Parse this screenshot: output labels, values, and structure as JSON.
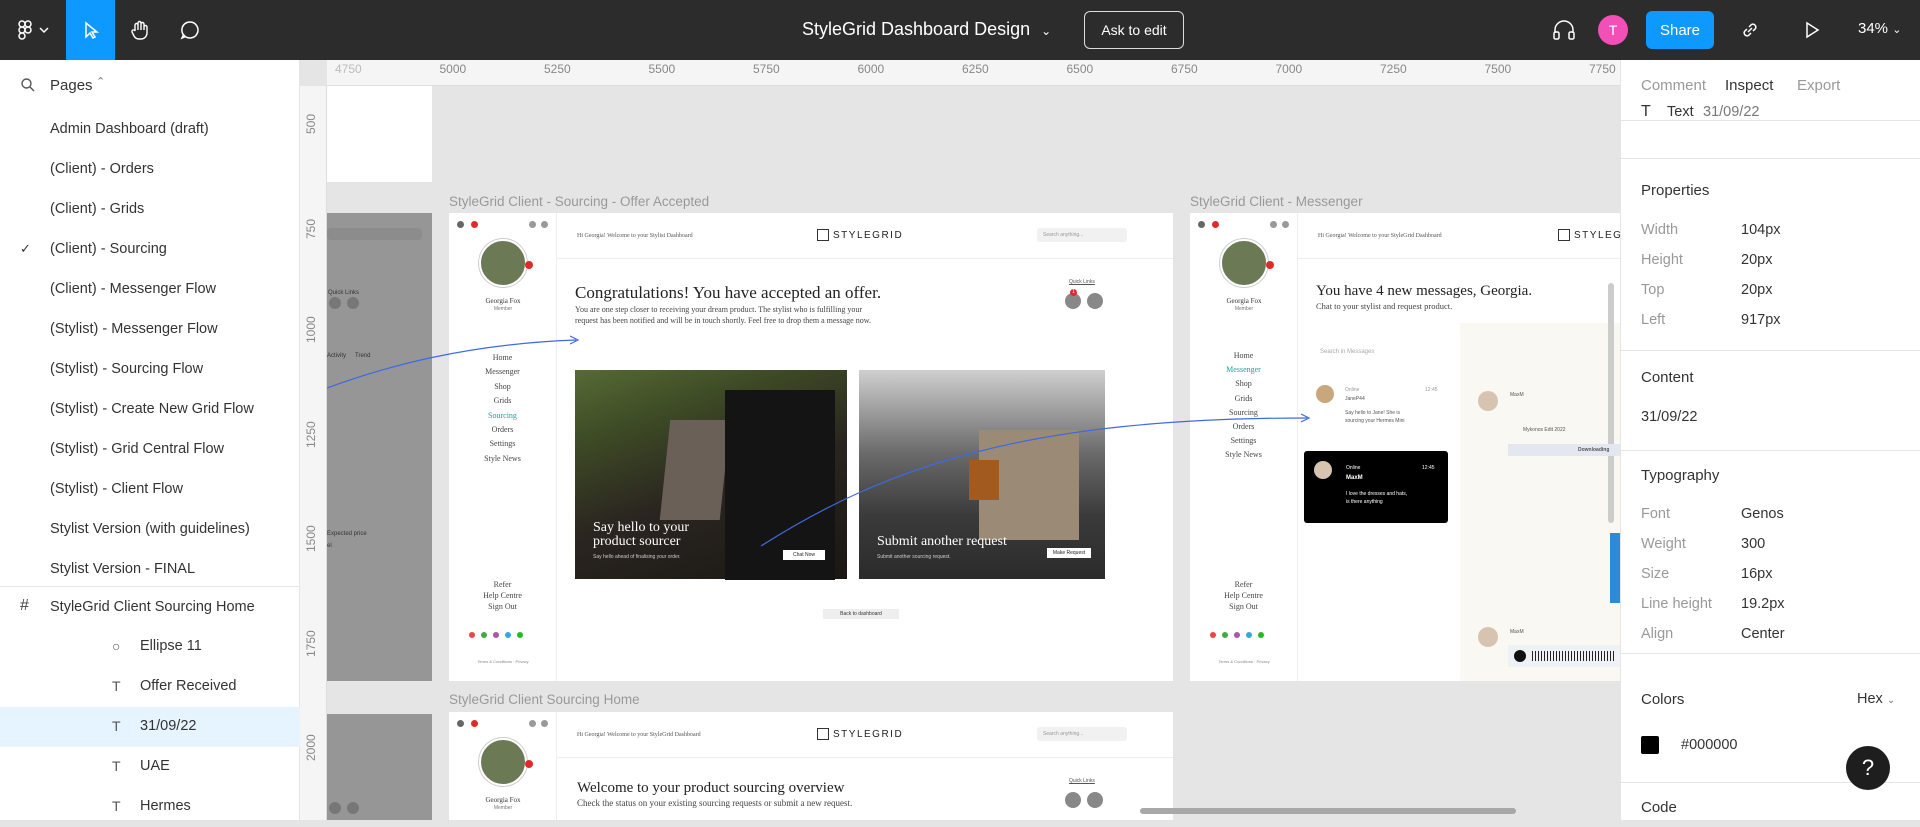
{
  "topbar": {
    "title": "StyleGrid Dashboard Design",
    "ask_to_edit": "Ask to edit",
    "avatar_initial": "T",
    "share": "Share",
    "zoom": "34%",
    "accent": "#0d99ff"
  },
  "pages_panel": {
    "label": "Pages",
    "items": [
      {
        "label": "Admin Dashboard (draft)"
      },
      {
        "label": "(Client) - Orders"
      },
      {
        "label": "(Client) - Grids"
      },
      {
        "label": "(Client) - Sourcing",
        "selected": true
      },
      {
        "label": "(Client) - Messenger Flow"
      },
      {
        "label": "(Stylist) - Messenger Flow"
      },
      {
        "label": "(Stylist) - Sourcing Flow"
      },
      {
        "label": "(Stylist) - Create New Grid Flow"
      },
      {
        "label": "(Stylist) - Grid Central Flow"
      },
      {
        "label": "(Stylist) - Client Flow"
      },
      {
        "label": "Stylist Version (with guidelines)"
      },
      {
        "label": "Stylist Version - FINAL"
      }
    ]
  },
  "layers": {
    "frame": "StyleGrid Client Sourcing Home",
    "items": [
      {
        "label": "Ellipse 11",
        "icon": "ellipse-icon"
      },
      {
        "label": "Offer Received",
        "icon": "text-icon"
      },
      {
        "label": "31/09/22",
        "icon": "text-icon",
        "selected": true
      },
      {
        "label": "UAE",
        "icon": "text-icon"
      },
      {
        "label": "Hermes",
        "icon": "text-icon"
      }
    ]
  },
  "ruler": {
    "top": [
      "4750",
      "5000",
      "5250",
      "5500",
      "5750",
      "6000",
      "6250",
      "6500",
      "6750",
      "7000",
      "7250",
      "7500",
      "7750"
    ],
    "left": [
      "500",
      "750",
      "1000",
      "1250",
      "1500",
      "1750",
      "2000"
    ]
  },
  "canvas": {
    "frame1_title": "StyleGrid Client - Sourcing - Offer Accepted",
    "frame2_title": "StyleGrid Client - Messenger",
    "frame3_title": "StyleGrid Client Sourcing Home",
    "left_partial": {
      "label1": "Quick Links",
      "t1": "Activity",
      "t2": "Trend",
      "t3": "Expected price",
      "t4": "el"
    },
    "f1": {
      "welcome": "Hi Georgia! Welcome to your Stylist Dashboard",
      "logo": "STYLEGRID",
      "search": "Search anything...",
      "quick_links": "Quick Links",
      "badge": "1",
      "profile_name": "Georgia Fox",
      "profile_role": "Member",
      "nav": [
        "Home",
        "Messenger",
        "Shop",
        "Grids",
        "Sourcing",
        "Orders",
        "Settings",
        "Style News"
      ],
      "bottom_nav": [
        "Refer",
        "Help Centre",
        "Sign Out"
      ],
      "footer": "Terms & Conditions · Privacy",
      "heading": "Congratulations! You have accepted an offer.",
      "sub1": "You are one step closer to receiving your dream product. The stylist who is fulfilling your",
      "sub2": "request has been notified and will be in touch shortly. Feel free to drop them a message now.",
      "card1_title1": "Say hello to your",
      "card1_title2": "product sourcer",
      "card1_sub": "Say hello ahead of finalising your order.",
      "card1_btn": "Chat Now",
      "card2_title": "Submit another request",
      "card2_sub": "Submit another sourcing request.",
      "card2_btn": "Make Request",
      "back": "Back to dashboard"
    },
    "f2": {
      "welcome": "Hi Georgia! Welcome to your StyleGrid Dashboard",
      "logo": "STYLEGR",
      "profile_name": "Georgia Fox",
      "profile_role": "Member",
      "nav": [
        "Home",
        "Messenger",
        "Shop",
        "Grids",
        "Sourcing",
        "Orders",
        "Settings",
        "Style News"
      ],
      "bottom_nav": [
        "Refer",
        "Help Centre",
        "Sign Out"
      ],
      "footer": "Terms & Conditions · Privacy",
      "heading": "You have 4 new messages, Georgia.",
      "sub": "Chat to your stylist and request product.",
      "search": "Search in Messages",
      "msg1_status": "Online",
      "msg1_time": "12:45",
      "msg1_name": "JaneP44",
      "msg1_text1": "Say hello to Jane! She is",
      "msg1_text2": "sourcing your Hermes Mini",
      "msg2_status": "Online",
      "msg2_time": "12:45",
      "msg2_name": "MaxM",
      "msg2_text1": "I love the dresses and hats,",
      "msg2_text2": "is there anything",
      "chat_name1": "MaxM",
      "chat_file": "Mykonos Edit 2022",
      "chat_download": "Downloading",
      "chat_name2": "MaxM"
    },
    "f3": {
      "welcome": "Hi Georgia! Welcome to your StyleGrid Dashboard",
      "logo": "STYLEGRID",
      "search": "Search anything...",
      "quick_links": "Quick Links",
      "profile_name": "Georgia Fox",
      "profile_role": "Member",
      "heading": "Welcome to your product sourcing overview",
      "sub": "Check the status on your existing sourcing requests or submit a new request."
    }
  },
  "inspect": {
    "tabs": [
      "Comment",
      "Inspect",
      "Export"
    ],
    "active_tab": "Inspect",
    "layer_type": "Text",
    "layer_name": "31/09/22",
    "properties_title": "Properties",
    "properties": [
      {
        "k": "Width",
        "v": "104px"
      },
      {
        "k": "Height",
        "v": "20px"
      },
      {
        "k": "Top",
        "v": "20px"
      },
      {
        "k": "Left",
        "v": "917px"
      }
    ],
    "content_title": "Content",
    "content": "31/09/22",
    "typography_title": "Typography",
    "typography": [
      {
        "k": "Font",
        "v": "Genos"
      },
      {
        "k": "Weight",
        "v": "300"
      },
      {
        "k": "Size",
        "v": "16px"
      },
      {
        "k": "Line height",
        "v": "19.2px"
      },
      {
        "k": "Align",
        "v": "Center"
      }
    ],
    "colors_title": "Colors",
    "color_format": "Hex",
    "color_value": "#000000",
    "code_title": "Code",
    "help": "?"
  }
}
